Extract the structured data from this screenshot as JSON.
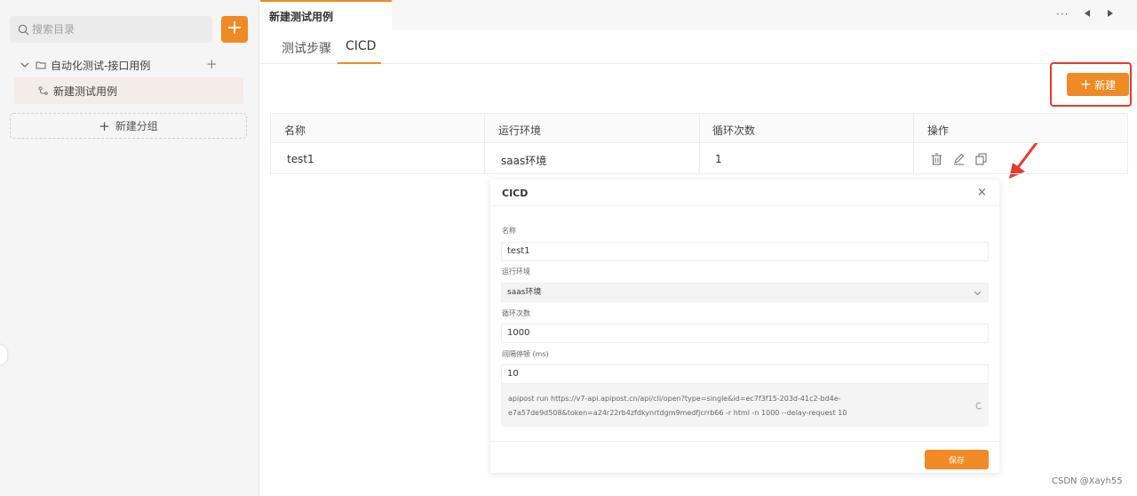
{
  "sidebar": {
    "search_placeholder": "搜索目录",
    "add_label": "+",
    "folder_label": "自动化测试-接口用例",
    "folder_add": "+",
    "item_label": "新建测试用例",
    "new_group_plus": "+",
    "new_group_label": "新建分组"
  },
  "tabbar": {
    "active_tab": "新建测试用例",
    "more": "···"
  },
  "subtabs": {
    "steps": "测试步骤",
    "cicd": "CICD"
  },
  "toolbar": {
    "new_plus": "+",
    "new_label": "新建"
  },
  "table": {
    "headers": [
      "名称",
      "运行环境",
      "循环次数",
      "操作"
    ],
    "rows": [
      {
        "name": "test1",
        "env": "saas环境",
        "loops": "1"
      }
    ]
  },
  "modal": {
    "title": "CICD",
    "close": "×",
    "name_label": "名称",
    "name_value": "test1",
    "env_label": "运行环境",
    "env_value": "saas环境",
    "loops_label": "循环次数",
    "loops_value": "1000",
    "interval_label": "间隔停顿 (ms)",
    "interval_value": "10",
    "command_line1": "apipost run https://v7-api.apipost.cn/api/cli/open?type=single&id=ec7f3f15-203d-41c2-bd4e-",
    "command_line2": "e7a57de9d508&token=a24r22rb4zfdkynrtdgm9medfjcrrb66 -r html -n 1000 --delay-request 10",
    "save_label": "保存"
  },
  "watermark": "CSDN @Xayh55",
  "colors": {
    "accent": "#f08a24",
    "highlight": "#e8392b"
  }
}
